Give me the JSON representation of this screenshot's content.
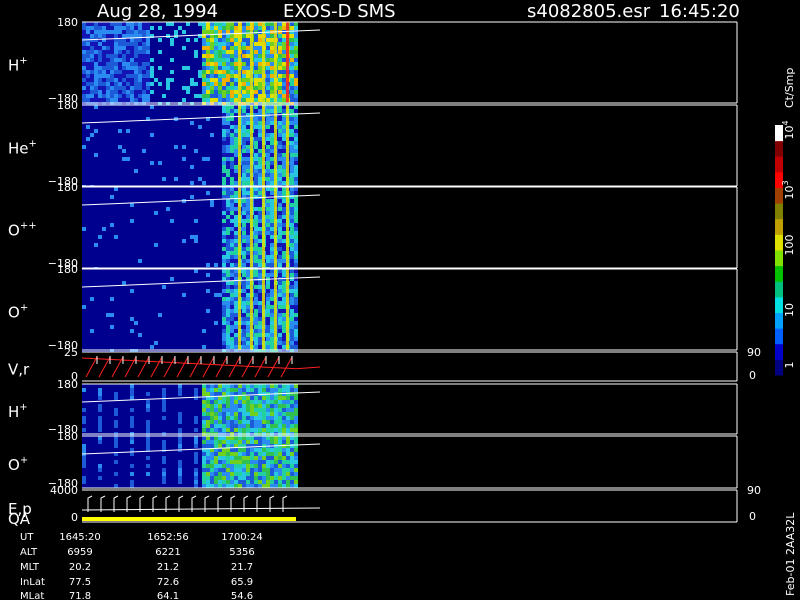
{
  "header": {
    "date": "Aug 28, 1994",
    "instrument": "EXOS-D SMS",
    "file": "s4082805.esr",
    "time": "16:45:20"
  },
  "colorbar": {
    "unit": "Ct/Smp",
    "ticks": [
      "1",
      "10",
      "100",
      "10",
      "10"
    ],
    "tick_exponents": [
      "",
      "",
      "",
      "3",
      "4"
    ],
    "colors": [
      "#000080",
      "#0000c8",
      "#0060ff",
      "#00a0ff",
      "#00e0e0",
      "#00c080",
      "#00c000",
      "#80e000",
      "#e0e000",
      "#c0a000",
      "#808000",
      "#a04000",
      "#ff0000",
      "#c00000",
      "#800000",
      "#ffffff"
    ]
  },
  "panels": [
    {
      "id": "h1",
      "label": "H",
      "sup": "+",
      "ymax": "180",
      "ymin": "−180",
      "right_top": "",
      "right_bottom": ""
    },
    {
      "id": "he",
      "label": "He",
      "sup": "+",
      "ymax": "180",
      "ymin": "−180",
      "right_top": "",
      "right_bottom": ""
    },
    {
      "id": "opp",
      "label": "O",
      "sup": "++",
      "ymax": "180",
      "ymin": "−180",
      "right_top": "",
      "right_bottom": ""
    },
    {
      "id": "op1",
      "label": "O",
      "sup": "+",
      "ymax": "180",
      "ymin": "−180",
      "right_top": "",
      "right_bottom": ""
    },
    {
      "id": "vr",
      "label": "V,r",
      "sup": "",
      "ymax": "25",
      "ymin": "0",
      "right_top": "90",
      "right_bottom": "0"
    },
    {
      "id": "h2",
      "label": "H",
      "sup": "+",
      "ymax": "180",
      "ymin": "−180",
      "right_top": "",
      "right_bottom": ""
    },
    {
      "id": "op2",
      "label": "O",
      "sup": "+",
      "ymax": "180",
      "ymin": "−180",
      "right_top": "",
      "right_bottom": ""
    },
    {
      "id": "ep",
      "label": "E,p",
      "sup": "",
      "ymax": "4000",
      "ymin": "0",
      "right_top": "90",
      "right_bottom": "0",
      "sub_label": "QA"
    }
  ],
  "orbit": {
    "labels": [
      "UT",
      "ALT",
      "MLT",
      "InLat",
      "MLat"
    ],
    "columns": [
      [
        "1645:20",
        "6959",
        "20.2",
        "77.5",
        "71.8"
      ],
      [
        "1652:56",
        "6221",
        "21.2",
        "72.6",
        "64.1"
      ],
      [
        "1700:24",
        "5356",
        "21.7",
        "65.9",
        "54.6"
      ]
    ]
  },
  "footer": {
    "stamp": "Feb-01 2AA32L"
  }
}
